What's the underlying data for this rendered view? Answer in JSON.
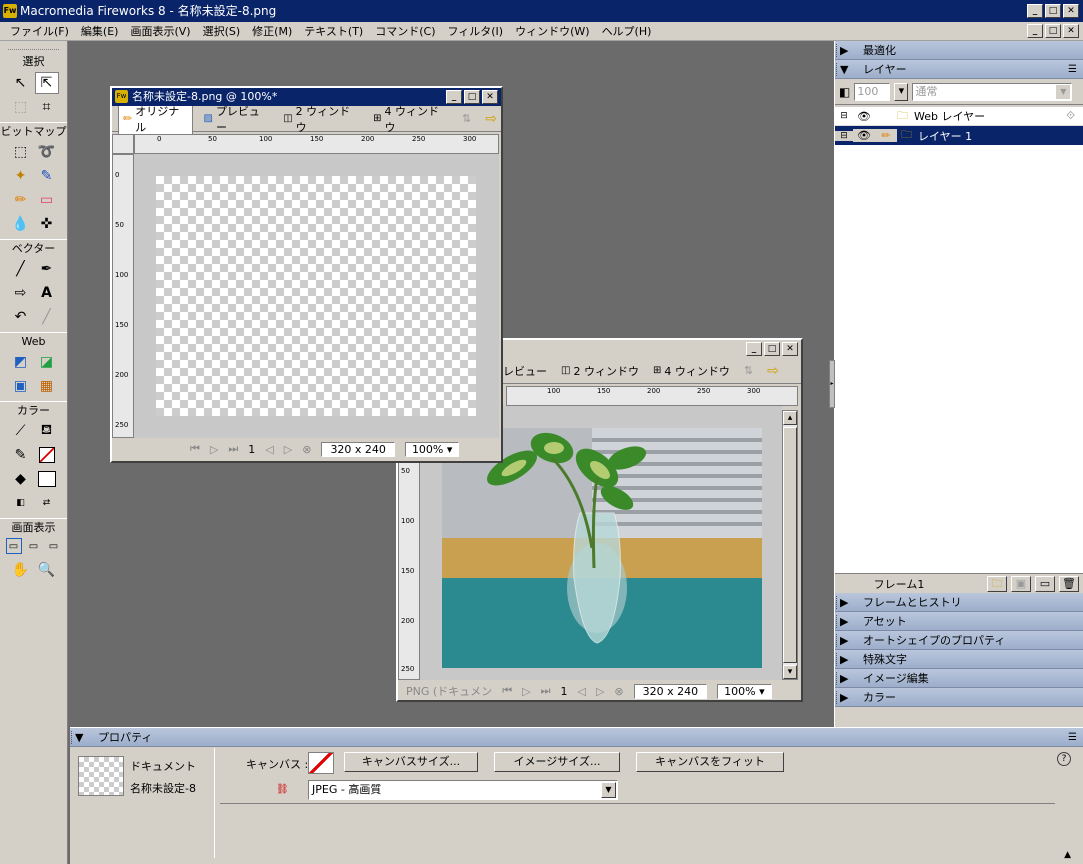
{
  "app": {
    "title": "Macromedia Fireworks 8 - 名称未設定-8.png",
    "icon": "Fw"
  },
  "menus": [
    "ファイル(F)",
    "編集(E)",
    "画面表示(V)",
    "選択(S)",
    "修正(M)",
    "テキスト(T)",
    "コマンド(C)",
    "フィルタ(I)",
    "ウィンドウ(W)",
    "ヘルプ(H)"
  ],
  "toolbox": {
    "sections": [
      "選択",
      "ビットマップ",
      "ベクター",
      "Web",
      "カラー",
      "画面表示"
    ]
  },
  "doc1": {
    "title": "名称未設定-8.png @ 100%*",
    "tabs": [
      "オリジナル",
      "プレビュー",
      "2 ウィンドウ",
      "4 ウィンドウ"
    ],
    "hruler": [
      "0",
      "50",
      "100",
      "150",
      "200",
      "250",
      "300"
    ],
    "vruler": [
      "0",
      "50",
      "100",
      "150",
      "200",
      "250"
    ],
    "page": "1",
    "size": "320 x 240",
    "zoom": "100%"
  },
  "doc2": {
    "tabs": [
      "プレビュー",
      "2 ウィンドウ",
      "4 ウィンドウ"
    ],
    "hruler": [
      "100",
      "150",
      "200",
      "250",
      "300"
    ],
    "vruler": [
      "50",
      "100",
      "150",
      "200",
      "250"
    ],
    "status_label": "PNG (ドキュメン",
    "page": "1",
    "size": "320 x 240",
    "zoom": "100%"
  },
  "panels": {
    "optimize": "最適化",
    "layers": "レイヤー",
    "opacity": "100",
    "blend": "通常",
    "layer_rows": [
      {
        "name": "Web レイヤー"
      },
      {
        "name": "レイヤー 1"
      }
    ],
    "frame": "フレーム1",
    "collapsed": [
      "フレームとヒストリ",
      "アセット",
      "オートシェイプのプロパティ",
      "特殊文字",
      "イメージ編集",
      "カラー"
    ]
  },
  "properties": {
    "title": "プロパティ",
    "doc_label": "ドキュメント",
    "doc_name": "名称未設定-8",
    "canvas_label": "キャンバス :",
    "buttons": [
      "キャンバスサイズ...",
      "イメージサイズ...",
      "キャンバスをフィット"
    ],
    "format": "JPEG - 高画質",
    "help": "?"
  },
  "colors": {
    "titlebar": "#0a246a",
    "layer_selected": "#0a246a",
    "workspace": "#6b6b6b",
    "panel": "#d4d0c8"
  }
}
